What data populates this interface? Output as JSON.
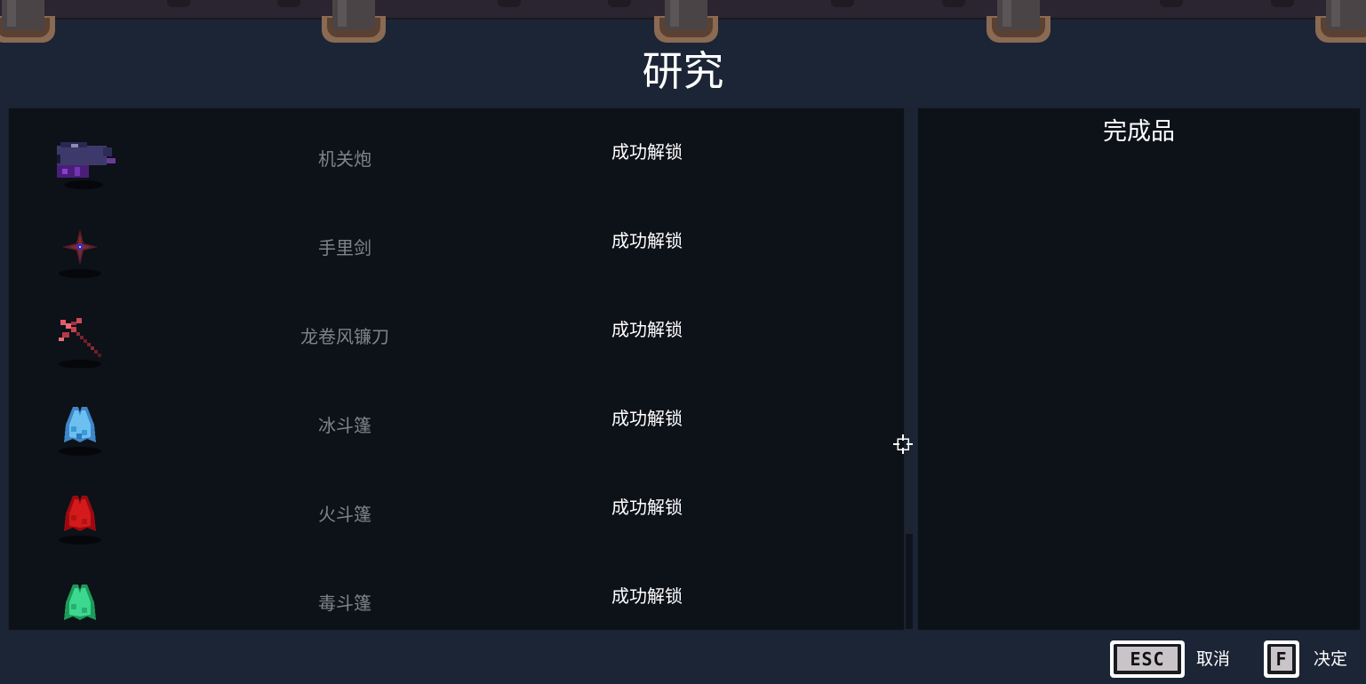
{
  "title": "研究",
  "research_list": [
    {
      "icon": "gatling-gun-icon",
      "name": "机关炮",
      "status": "成功解锁"
    },
    {
      "icon": "shuriken-icon",
      "name": "手里剑",
      "status": "成功解锁"
    },
    {
      "icon": "tornado-scythe-icon",
      "name": "龙卷风镰刀",
      "status": "成功解锁"
    },
    {
      "icon": "ice-cloak-icon",
      "name": "冰斗篷",
      "status": "成功解锁"
    },
    {
      "icon": "fire-cloak-icon",
      "name": "火斗篷",
      "status": "成功解锁"
    },
    {
      "icon": "poison-cloak-icon",
      "name": "毒斗篷",
      "status": "成功解锁"
    }
  ],
  "result_panel": {
    "title": "完成品"
  },
  "controls": {
    "cancel": {
      "key": "ESC",
      "label": "取消"
    },
    "confirm": {
      "key": "F",
      "label": "决定"
    }
  },
  "colors": {
    "background": "#1c2535",
    "panel": "#0d1118",
    "item_name": "#7f848c",
    "status": "#ffffff"
  }
}
